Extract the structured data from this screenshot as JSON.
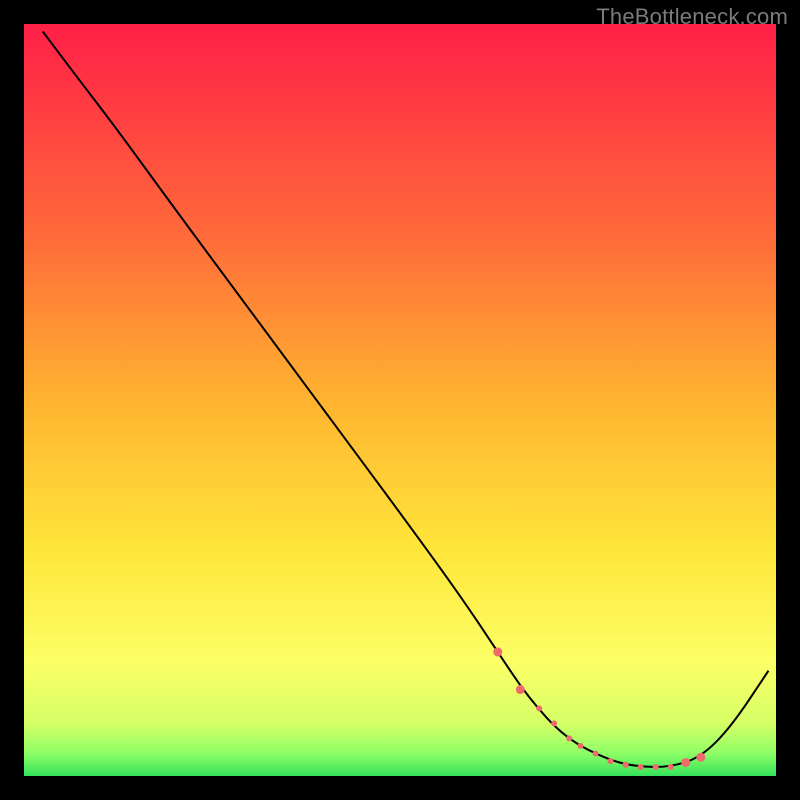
{
  "watermark": "TheBottleneck.com",
  "chart_data": {
    "type": "line",
    "title": "",
    "xlabel": "",
    "ylabel": "",
    "xlim": [
      0,
      100
    ],
    "ylim": [
      0,
      100
    ],
    "gradient_stops": [
      {
        "offset": 0.0,
        "color": "#ff1f47"
      },
      {
        "offset": 0.28,
        "color": "#ff6a3a"
      },
      {
        "offset": 0.5,
        "color": "#ffb330"
      },
      {
        "offset": 0.7,
        "color": "#ffe63a"
      },
      {
        "offset": 0.85,
        "color": "#fbff66"
      },
      {
        "offset": 0.93,
        "color": "#d6ff66"
      },
      {
        "offset": 0.97,
        "color": "#8dff66"
      },
      {
        "offset": 1.0,
        "color": "#35e25b"
      }
    ],
    "series": [
      {
        "name": "curve",
        "color": "#000000",
        "x": [
          2.5,
          7.0,
          12.0,
          20.0,
          30.0,
          40.0,
          50.0,
          58.0,
          63.0,
          67.0,
          72.0,
          78.0,
          82.0,
          86.0,
          90.0,
          94.0,
          99.0
        ],
        "y": [
          99.0,
          93.0,
          86.5,
          75.5,
          62.0,
          48.5,
          35.0,
          24.0,
          16.5,
          10.5,
          5.0,
          2.0,
          1.2,
          1.2,
          2.5,
          6.5,
          14.0
        ]
      }
    ],
    "markers": {
      "color": "#ef6b6b",
      "x": [
        63.0,
        66.0,
        68.5,
        70.5,
        72.5,
        74.0,
        76.0,
        78.0,
        80.0,
        82.0,
        84.0,
        86.0,
        88.0,
        90.0
      ],
      "y": [
        16.5,
        11.5,
        9.0,
        7.0,
        5.0,
        4.0,
        3.0,
        2.0,
        1.5,
        1.2,
        1.2,
        1.2,
        1.8,
        2.5
      ],
      "r": [
        4.5,
        4.5,
        3.0,
        3.0,
        3.0,
        3.0,
        3.0,
        3.0,
        3.0,
        3.0,
        3.0,
        3.0,
        4.5,
        4.5
      ]
    }
  }
}
